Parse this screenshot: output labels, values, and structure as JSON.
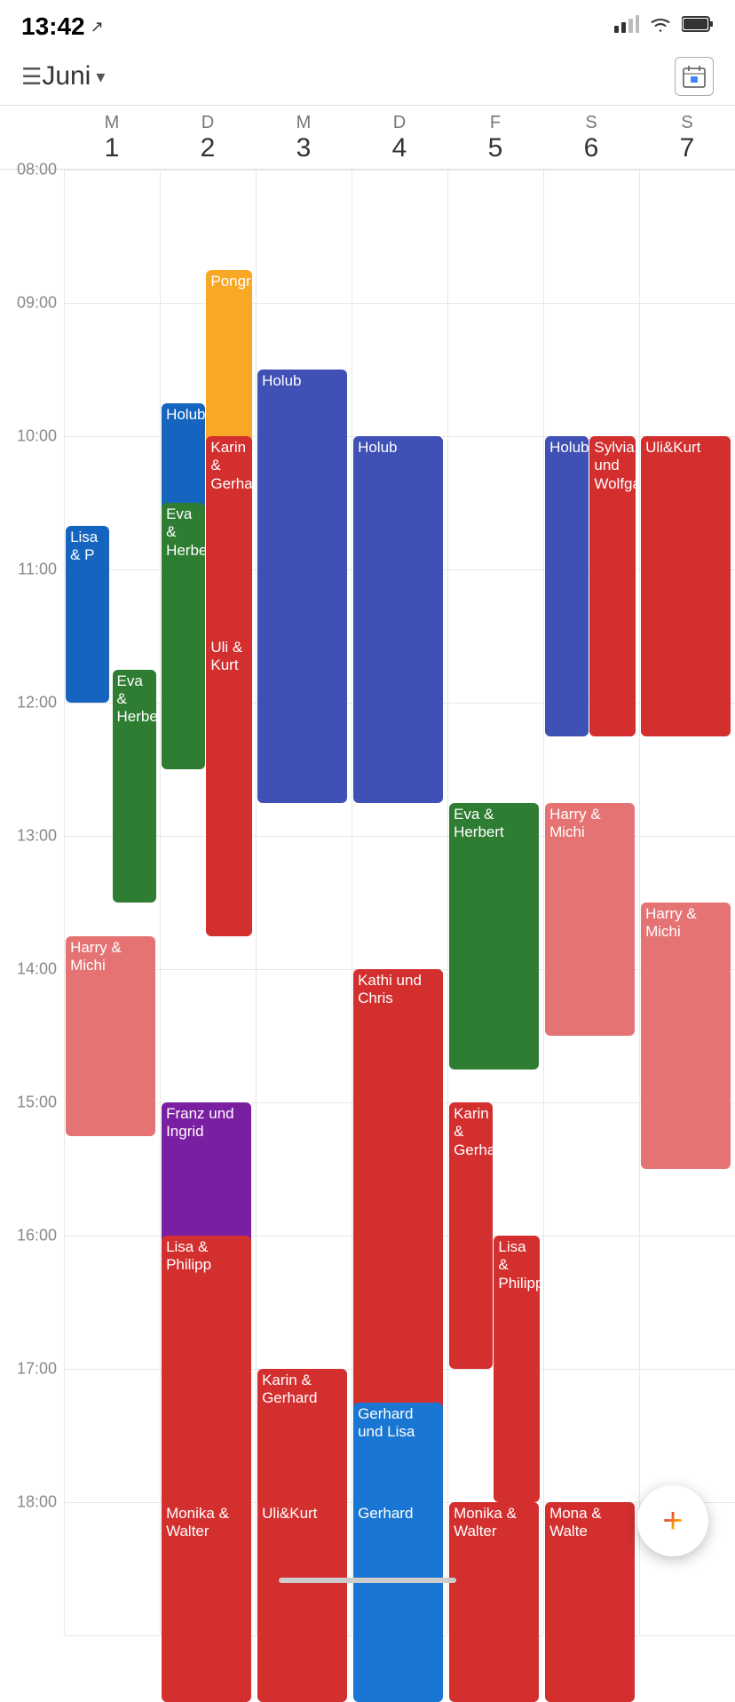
{
  "statusBar": {
    "time": "13:42",
    "navigationIcon": "↗",
    "signalBars": "▂▄▆",
    "wifiIcon": "wifi",
    "batteryIcon": "battery"
  },
  "header": {
    "menuLabel": "☰",
    "monthLabel": "Juni",
    "dropdownIcon": "▾",
    "calendarIcon": "📅"
  },
  "dayHeaders": [
    {
      "letter": "M",
      "number": "1"
    },
    {
      "letter": "D",
      "number": "2"
    },
    {
      "letter": "M",
      "number": "3"
    },
    {
      "letter": "D",
      "number": "4"
    },
    {
      "letter": "F",
      "number": "5"
    },
    {
      "letter": "S",
      "number": "6"
    },
    {
      "letter": "S",
      "number": "7"
    }
  ],
  "timeLabels": [
    "08:00",
    "09:00",
    "10:00",
    "11:00",
    "12:00",
    "13:00",
    "14:00",
    "15:00",
    "16:00",
    "17:00",
    "18:00"
  ],
  "hourHeightPx": 150,
  "startHour": 8,
  "colors": {
    "blue": "#3F51B5",
    "red": "#D32F2F",
    "green": "#2E7D32",
    "yellow": "#F9A825",
    "purple": "#7B1FA2",
    "pink": "#E57373",
    "lightBlue": "#1976D2",
    "teal": "#00897B"
  },
  "events": {
    "col1": [
      {
        "label": "Lisa & P",
        "color": "#1565C0",
        "startH": 10.67,
        "endH": 12.0
      },
      {
        "label": "Eva & Herbert",
        "color": "#2E7D32",
        "startH": 11.75,
        "endH": 13.5
      },
      {
        "label": "Harry & Michi",
        "color": "#E57373",
        "startH": 13.75,
        "endH": 15.25
      }
    ],
    "col2": [
      {
        "label": "Pongracz",
        "color": "#F9A825",
        "startH": 8.75,
        "endH": 10.5
      },
      {
        "label": "Holub",
        "color": "#1565C0",
        "startH": 9.75,
        "endH": 11.25
      },
      {
        "label": "Karin & Gerha",
        "color": "#D32F2F",
        "startH": 10.0,
        "endH": 11.75
      },
      {
        "label": "Eva & Herbert",
        "color": "#2E7D32",
        "startH": 10.5,
        "endH": 12.25
      },
      {
        "label": "Uli & Kurt",
        "color": "#D32F2F",
        "startH": 11.5,
        "endH": 13.75
      },
      {
        "label": "Franz und Ingrid",
        "color": "#7B1FA2",
        "startH": 15.0,
        "endH": 16.5
      },
      {
        "label": "Lisa & Philipp",
        "color": "#D32F2F",
        "startH": 16.0,
        "endH": 18.25
      },
      {
        "label": "Monika & Walter",
        "color": "#D32F2F",
        "startH": 18.0,
        "endH": 19.5
      }
    ],
    "col3": [
      {
        "label": "Holub",
        "color": "#1565C0",
        "startH": 9.5,
        "endH": 11.0
      },
      {
        "label": "Holub",
        "color": "#3F51B5",
        "startH": 10.0,
        "endH": 12.75
      },
      {
        "label": "Karin & Gerhard",
        "color": "#D32F2F",
        "startH": 17.0,
        "endH": 18.5
      },
      {
        "label": "Uli&Kurt",
        "color": "#D32F2F",
        "startH": 18.0,
        "endH": 19.5
      }
    ],
    "col4": [
      {
        "label": "Kathi und Chris",
        "color": "#D32F2F",
        "startH": 14.0,
        "endH": 17.5
      },
      {
        "label": "Gerhard und Lisa",
        "color": "#1976D2",
        "startH": 17.25,
        "endH": 18.5
      },
      {
        "label": "Gerhard",
        "color": "#1976D2",
        "startH": 18.0,
        "endH": 19.5
      }
    ],
    "col5": [
      {
        "label": "Eva & Herbert",
        "color": "#2E7D32",
        "startH": 12.75,
        "endH": 14.75
      },
      {
        "label": "Karin & Gerhard",
        "color": "#D32F2F",
        "startH": 15.0,
        "endH": 17.0
      },
      {
        "label": "Lisa & Philipp",
        "color": "#D32F2F",
        "startH": 16.0,
        "endH": 18.0
      },
      {
        "label": "Monika & Walter",
        "color": "#D32F2F",
        "startH": 18.0,
        "endH": 19.5
      }
    ],
    "col6": [
      {
        "label": "Holub",
        "color": "#3F51B5",
        "startH": 10.0,
        "endH": 12.25
      },
      {
        "label": "Sylvia und Wolfgang",
        "color": "#D32F2F",
        "startH": 10.0,
        "endH": 12.25
      },
      {
        "label": "Harry & Michi",
        "color": "#E57373",
        "startH": 12.75,
        "endH": 14.5
      },
      {
        "label": "Mona & Walte",
        "color": "#D32F2F",
        "startH": 18.0,
        "endH": 19.5
      }
    ],
    "col7": [
      {
        "label": "Uli&Kurt",
        "color": "#D32F2F",
        "startH": 10.0,
        "endH": 12.25
      },
      {
        "label": "Harry & Michi",
        "color": "#E57373",
        "startH": 13.5,
        "endH": 15.5
      }
    ]
  },
  "fab": {
    "label": "+"
  }
}
